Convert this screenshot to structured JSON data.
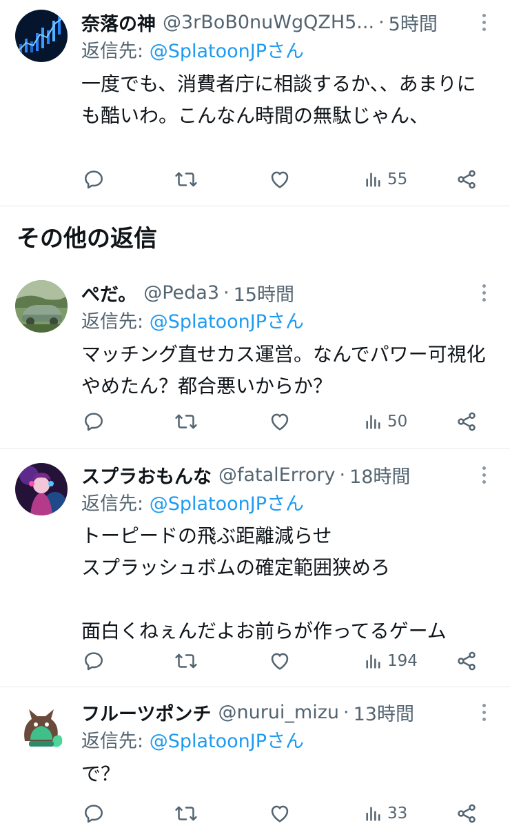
{
  "reply_to_prefix": "返信先:",
  "section_title": "その他の返信",
  "tweets": [
    {
      "display_name": "奈落の神",
      "handle": "@3rBoB0nuWgQZH5...",
      "time": "5時間",
      "reply_to": "@SplatoonJPさん",
      "text": "一度でも、消費者庁に相談するか、、あまりにも酷いわ。こんなん時間の無駄じゃん、",
      "views": "55"
    },
    {
      "display_name": "ぺだ。",
      "handle": "@Peda3",
      "time": "15時間",
      "reply_to": "@SplatoonJPさん",
      "text": "マッチング直せカス運営。なんでパワー可視化やめたん？都合悪いからか？",
      "views": "50"
    },
    {
      "display_name": "スプラおもんな",
      "handle": "@fatalErrory",
      "time": "18時間",
      "reply_to": "@SplatoonJPさん",
      "text": "トーピードの飛ぶ距離減らせ\nスプラッシュボムの確定範囲狭めろ\n\n面白くねぇんだよお前らが作ってるゲーム",
      "views": "194"
    },
    {
      "display_name": "フルーツポンチ",
      "handle": "@nurui_mizu",
      "time": "13時間",
      "reply_to": "@SplatoonJPさん",
      "text": "で？",
      "views": "33"
    }
  ],
  "icons": {
    "reply": "reply-icon",
    "retweet": "retweet-icon",
    "like": "heart-icon",
    "views": "bar-chart-icon",
    "share": "share-icon",
    "more": "more-options-icon"
  },
  "colors": {
    "link": "#1d9bf0",
    "secondary_text": "#536471",
    "divider": "#e7e7e7"
  }
}
